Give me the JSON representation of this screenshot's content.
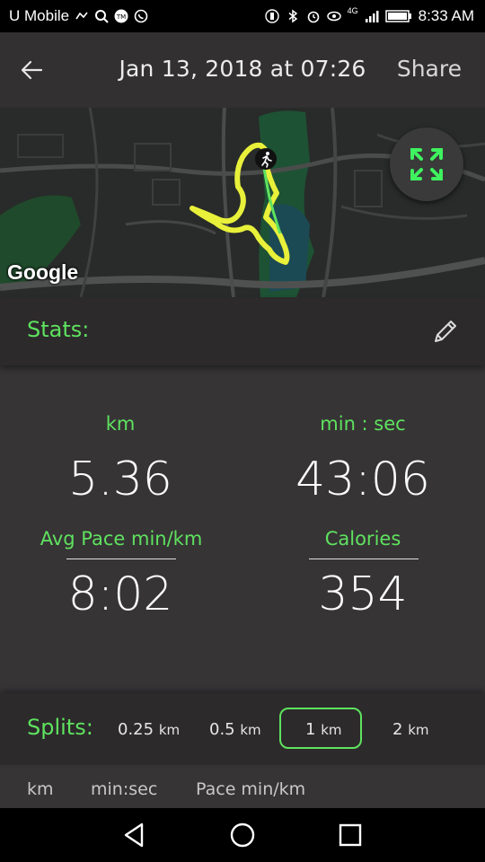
{
  "status_bar": {
    "carrier": "U Mobile",
    "network": "4G",
    "time": "8:33 AM"
  },
  "header": {
    "title": "Jan 13, 2018 at 07:26",
    "share_label": "Share"
  },
  "map": {
    "attribution": "Google"
  },
  "stats": {
    "label": "Stats:",
    "distance_label": "km",
    "distance_value": "5.36",
    "time_label": "min : sec",
    "time_value": "43:06",
    "pace_label": "Avg Pace min/km",
    "pace_value": "8:02",
    "calories_label": "Calories",
    "calories_value": "354"
  },
  "splits": {
    "label": "Splits:",
    "options": [
      {
        "value": "0.25",
        "unit": "km"
      },
      {
        "value": "0.5",
        "unit": "km"
      },
      {
        "value": "1",
        "unit": "km"
      },
      {
        "value": "2",
        "unit": "km"
      }
    ],
    "selected": "1 km",
    "columns": [
      "km",
      "min:sec",
      "Pace min/km"
    ]
  },
  "colors": {
    "accent": "#5fe25f",
    "route": "#e8f03a",
    "background": "#363435"
  }
}
